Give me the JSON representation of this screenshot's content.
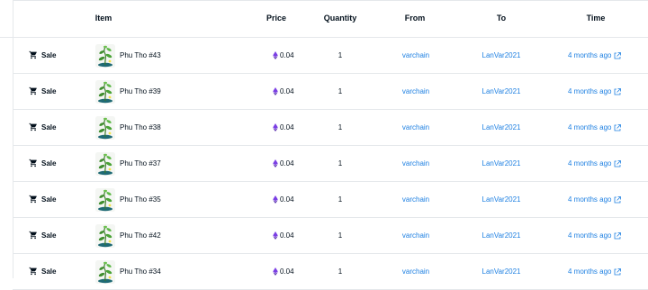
{
  "headers": {
    "item": "Item",
    "price": "Price",
    "quantity": "Quantity",
    "from": "From",
    "to": "To",
    "time": "Time"
  },
  "accent_color": "#2081e2",
  "currency_icon": "ethereum-icon",
  "event_icon": "cart-icon",
  "rows": [
    {
      "event": "Sale",
      "item": "Phu Tho #43",
      "price": "0.04",
      "quantity": "1",
      "from": "varchain",
      "to": "LanVar2021",
      "time": "4 months ago"
    },
    {
      "event": "Sale",
      "item": "Phu Tho #39",
      "price": "0.04",
      "quantity": "1",
      "from": "varchain",
      "to": "LanVar2021",
      "time": "4 months ago"
    },
    {
      "event": "Sale",
      "item": "Phu Tho #38",
      "price": "0.04",
      "quantity": "1",
      "from": "varchain",
      "to": "LanVar2021",
      "time": "4 months ago"
    },
    {
      "event": "Sale",
      "item": "Phu Tho #37",
      "price": "0.04",
      "quantity": "1",
      "from": "varchain",
      "to": "LanVar2021",
      "time": "4 months ago"
    },
    {
      "event": "Sale",
      "item": "Phu Tho #35",
      "price": "0.04",
      "quantity": "1",
      "from": "varchain",
      "to": "LanVar2021",
      "time": "4 months ago"
    },
    {
      "event": "Sale",
      "item": "Phu Tho #42",
      "price": "0.04",
      "quantity": "1",
      "from": "varchain",
      "to": "LanVar2021",
      "time": "4 months ago"
    },
    {
      "event": "Sale",
      "item": "Phu Tho #34",
      "price": "0.04",
      "quantity": "1",
      "from": "varchain",
      "to": "LanVar2021",
      "time": "4 months ago"
    }
  ]
}
